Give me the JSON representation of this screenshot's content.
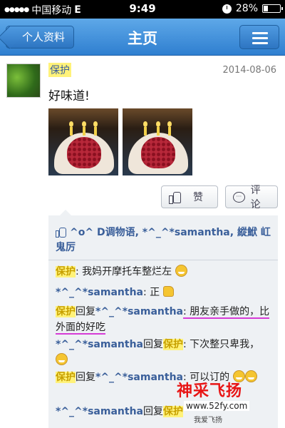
{
  "status_bar": {
    "carrier": "中国移动",
    "network": "E",
    "time": "9:49",
    "battery": "28%",
    "battery_level": 0.28
  },
  "nav": {
    "back_label": "个人资料",
    "title": "主页",
    "menu_icon": "hamburger-menu-icon"
  },
  "post": {
    "author": "保护",
    "date": "2014-08-06",
    "text": "好味道!",
    "photos": [
      "birthday-cake-photo",
      "birthday-cake-photo"
    ],
    "like_label": "赞",
    "comment_label": "评论"
  },
  "comments_panel": {
    "likes_text": "^o^ D调物语, *^_^*samantha, 縱鮲 屸鬼厉",
    "comments": [
      {
        "author": "保护",
        "text": ": 我妈开摩托车整烂左",
        "emoji": "emoji-smile"
      },
      {
        "author": "*^_^*samantha",
        "text": ": 正",
        "emoji": "emoji-thumbs-up"
      },
      {
        "author": "保护",
        "reply_word": "回复",
        "reply_to": "*^_^*samantha",
        "text": ": 朋友亲手做的，比外面的好吃"
      },
      {
        "author": "*^_^*samantha",
        "reply_word": "回复",
        "reply_to": "保护",
        "text": ": 下次整只卑我，",
        "emoji": "emoji-grin"
      },
      {
        "author": "保护",
        "reply_word": "回复",
        "reply_to": "*^_^*samantha",
        "text": ": 可以订的",
        "emoji": "emoji-grin"
      },
      {
        "author": "*^_^*samantha",
        "reply_word": "回复",
        "reply_to": "保护",
        "text": ""
      }
    ]
  },
  "watermark": {
    "main": "神采飞扬",
    "url": "www.52fy.com",
    "sub": "我爱飞扬"
  },
  "colors": {
    "nav_blue": "#3d8ad8",
    "link_blue": "#3a5f9a",
    "highlight": "#fff27a",
    "underline": "#d63cd6",
    "watermark_red": "#e81515"
  }
}
